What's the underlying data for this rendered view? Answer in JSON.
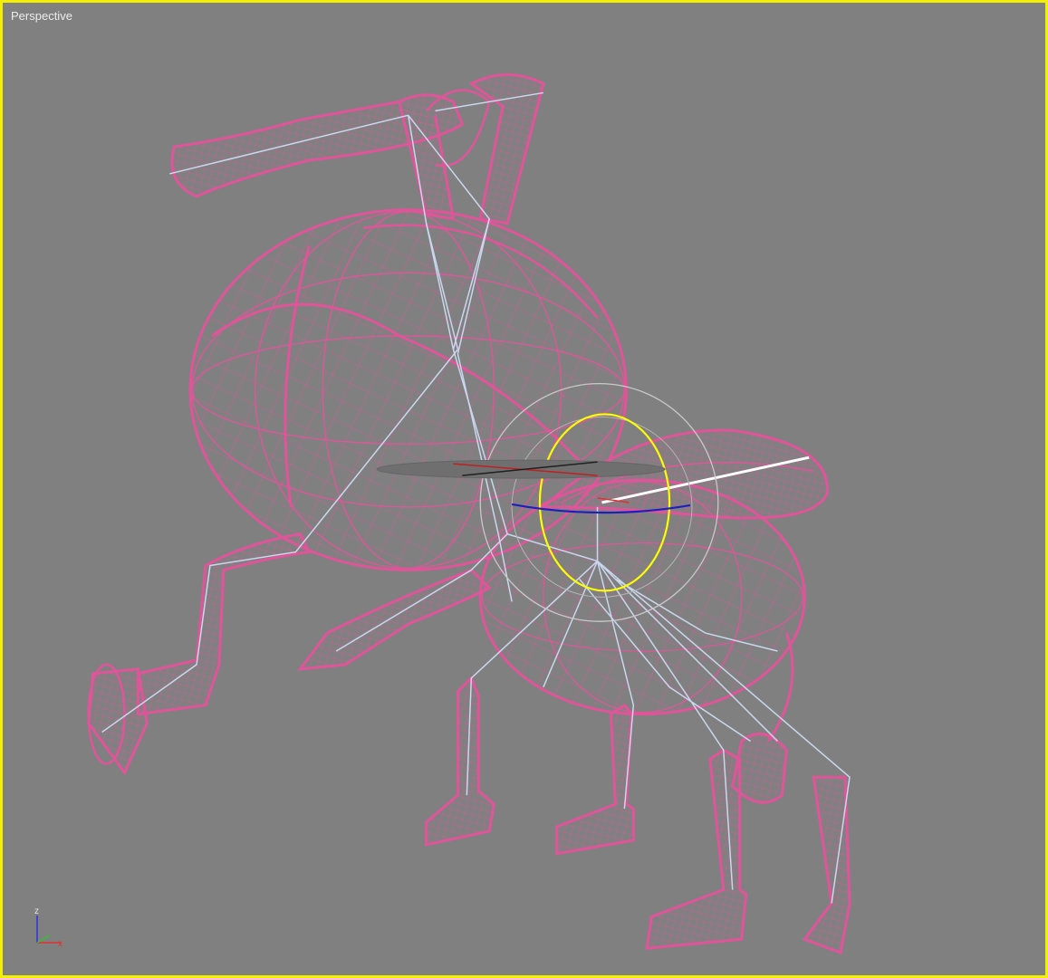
{
  "viewport": {
    "label": "Perspective",
    "border_color": "#f2f000",
    "background_color": "#808080",
    "active": true
  },
  "scene": {
    "object": "character-rig",
    "wire_color": "#e0559a",
    "bone_color": "#c9d8ee",
    "gizmo_outer_color": "#c8c8c8",
    "gizmo_yellow_color": "#ffff00",
    "gizmo_blue_color": "#1f1fbf"
  },
  "axis_tripod": {
    "z": "z",
    "x": "x",
    "colors": {
      "x": "#e03030",
      "y": "#30c030",
      "z": "#3030e0"
    }
  },
  "icons": [
    "axis-tripod-icon",
    "transform-gizmo-icon"
  ]
}
